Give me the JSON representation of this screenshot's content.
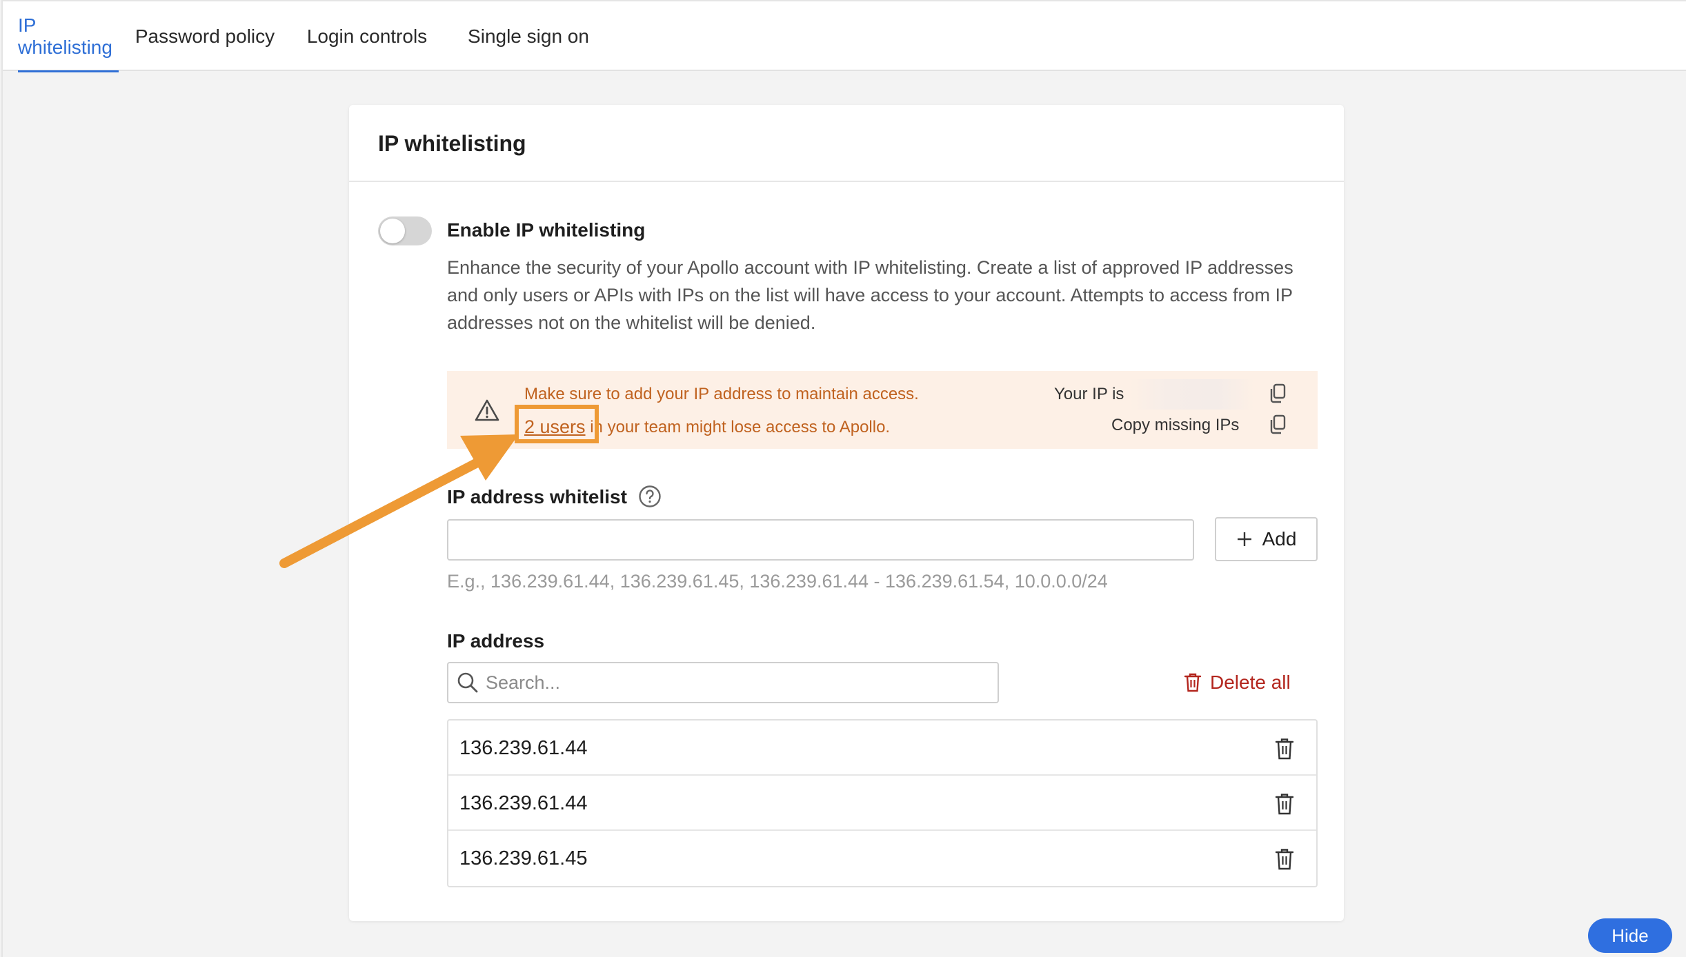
{
  "tabs": [
    {
      "label": "IP whitelisting",
      "active": true
    },
    {
      "label": "Password policy",
      "active": false
    },
    {
      "label": "Login controls",
      "active": false
    },
    {
      "label": "Single sign on",
      "active": false
    }
  ],
  "card": {
    "title": "IP whitelisting",
    "toggle": {
      "label": "Enable IP whitelisting",
      "enabled": false
    },
    "description": "Enhance the security of your Apollo account with IP whitelisting. Create a list of approved IP addresses and only users or APIs with IPs on the list will have access to your account. Attempts to access from IP addresses not on the whitelist will be denied."
  },
  "warning": {
    "line1": "Make sure to add your IP address to maintain access.",
    "link_text": "2 users",
    "line2_rest": " in your team might lose access to Apollo.",
    "your_ip_label": "Your IP is",
    "copy_missing_label": "Copy missing IPs",
    "color": "#c0621f"
  },
  "whitelist": {
    "label": "IP address whitelist",
    "input_value": "",
    "add_label": "Add",
    "example": "E.g., 136.239.61.44, 136.239.61.45, 136.239.61.44 - 136.239.61.54, 10.0.0.0/24"
  },
  "ip_list": {
    "label": "IP address",
    "search_placeholder": "Search...",
    "delete_all_label": "Delete all",
    "rows": [
      "136.239.61.44",
      "136.239.61.44",
      "136.239.61.45"
    ]
  },
  "hide_label": "Hide",
  "colors": {
    "accent": "#2f6fd6",
    "danger": "#b3261e",
    "annotation": "#ee9a35"
  }
}
